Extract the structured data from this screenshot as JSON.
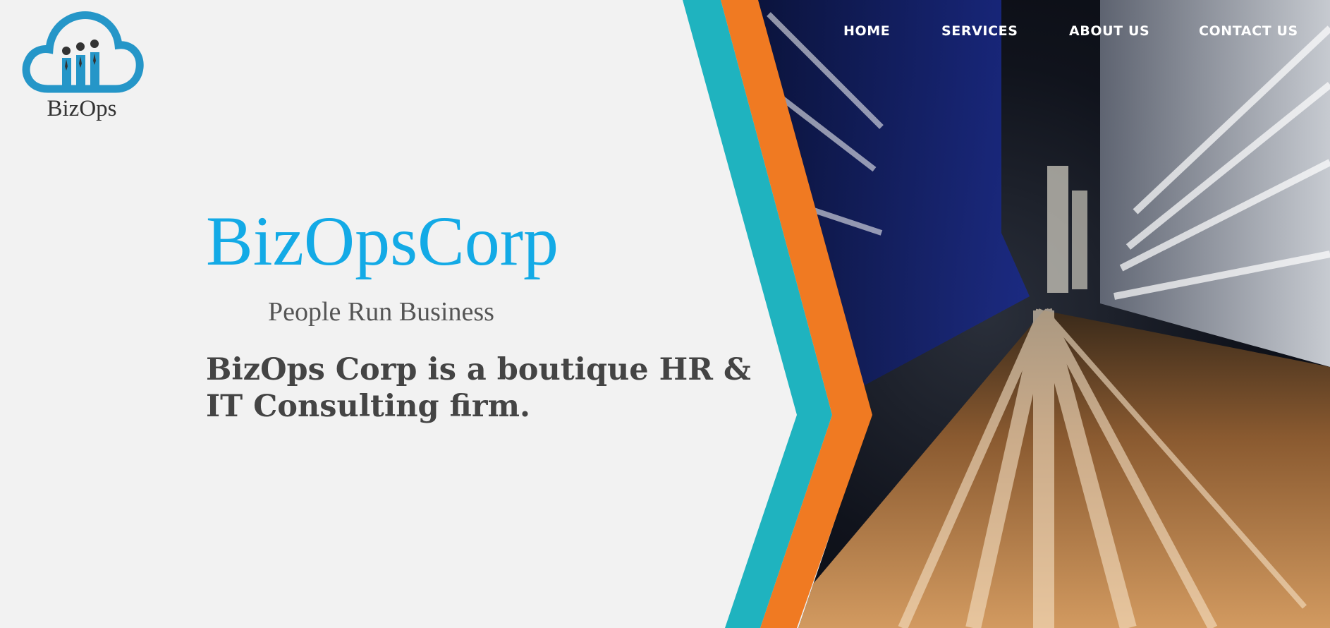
{
  "logo": {
    "text": "BizOps",
    "icon": "cloud-people-icon"
  },
  "nav": {
    "items": [
      {
        "label": "HOME"
      },
      {
        "label": "SERVICES"
      },
      {
        "label": "ABOUT US"
      },
      {
        "label": "CONTACT US"
      }
    ]
  },
  "hero": {
    "title": "BizOpsCorp",
    "subtitle": "People Run Business",
    "description": "BizOps Corp is a boutique HR & IT Consulting firm."
  },
  "colors": {
    "accent_blue": "#13aae6",
    "teal_band": "#1fb3bf",
    "orange_band": "#f07a22",
    "background": "#f2f2f2",
    "text_dark": "#444444"
  }
}
